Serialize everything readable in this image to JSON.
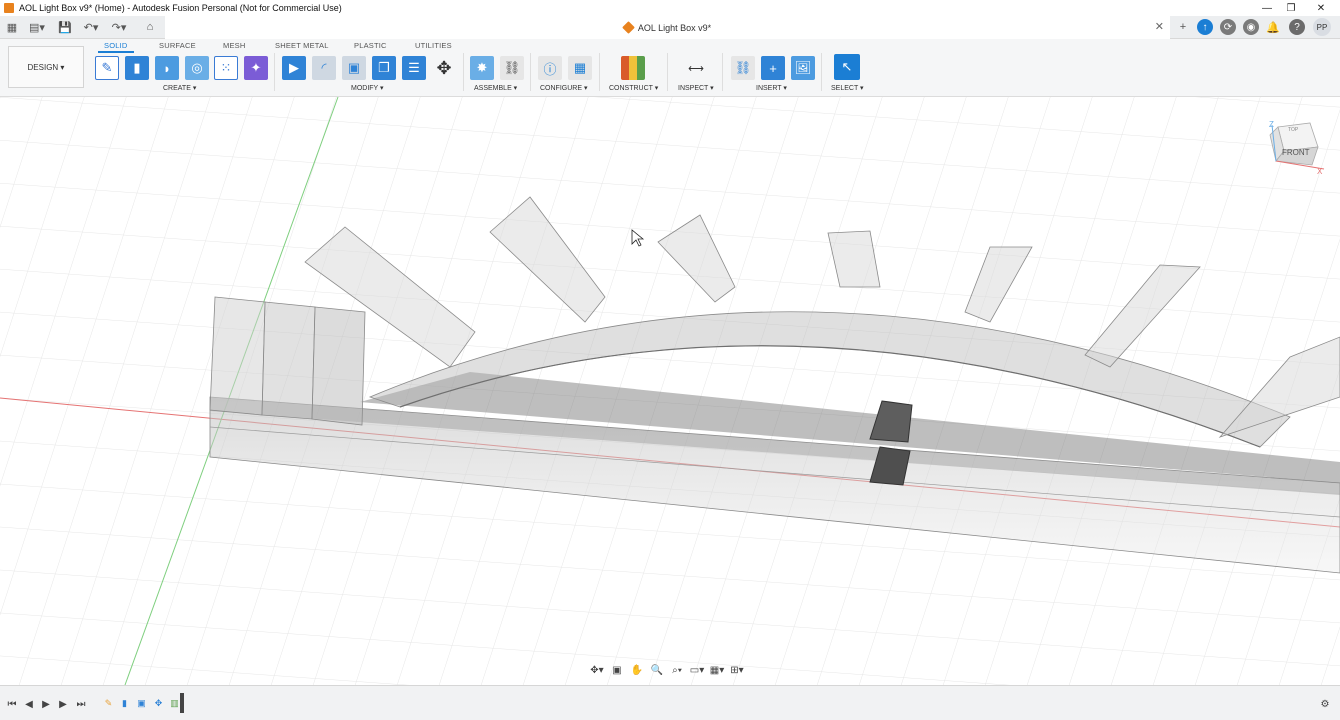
{
  "window": {
    "title": "AOL Light Box v9* (Home) - Autodesk Fusion Personal (Not for Commercial Use)",
    "minimize": "—",
    "maximize": "❐",
    "close": "✕"
  },
  "tabbar": {
    "doc_tab_title": "AOL Light Box v9*",
    "doc_tab_close": "✕",
    "user_initials": "PP"
  },
  "ribbon": {
    "workspace": "DESIGN ▾",
    "tabs": [
      "SOLID",
      "SURFACE",
      "MESH",
      "SHEET METAL",
      "PLASTIC",
      "UTILITIES"
    ],
    "active_tab": "SOLID",
    "groups": {
      "create": "CREATE ▾",
      "modify": "MODIFY ▾",
      "assemble": "ASSEMBLE ▾",
      "configure": "CONFIGURE ▾",
      "construct": "CONSTRUCT ▾",
      "inspect": "INSPECT ▾",
      "insert": "INSERT ▾",
      "select": "SELECT ▾"
    }
  },
  "viewcube": {
    "front": "FRONT",
    "top": "TOP",
    "axis_z": "Z",
    "axis_x": "X"
  },
  "colors": {
    "accent": "#1b7ed4",
    "fusion_orange": "#e8821e",
    "grid": "#e4e4e4",
    "axis_red": "#e57373",
    "axis_green": "#7fcf7f"
  }
}
